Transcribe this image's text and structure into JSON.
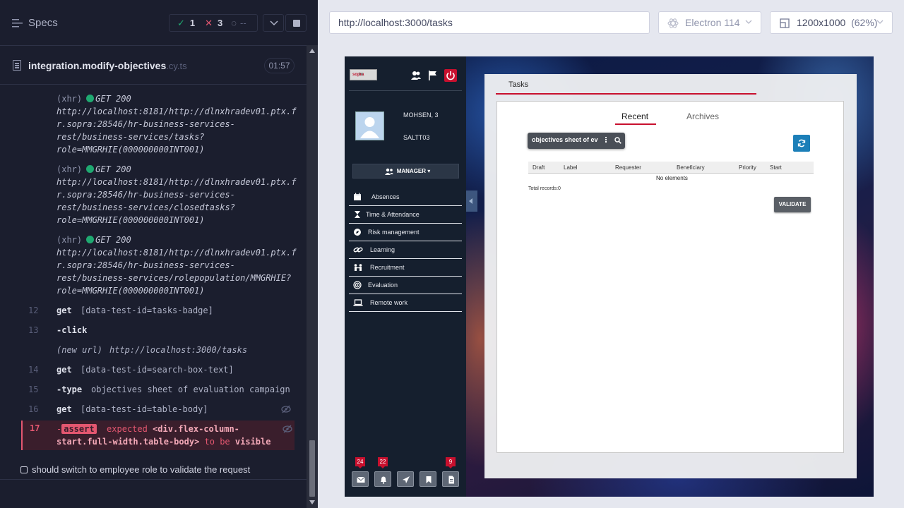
{
  "runner": {
    "specs_title": "Specs",
    "stats": {
      "passed": "1",
      "failed": "3",
      "pending": "--",
      "pass_glyph": "✓",
      "fail_glyph": "✕",
      "pending_glyph": "◌"
    },
    "spec_file": {
      "name": "integration.modify-objectives",
      "ext": ".cy.ts",
      "duration": "01:57"
    },
    "xhr_entries": [
      {
        "tag": "(xhr)",
        "status": "GET 200",
        "line1": "http://localhost:8181/http://dlnxhradev01.ptx.f",
        "line2": "r.sopra:28546/hr-business-services-",
        "line3": "rest/business-services/tasks?",
        "line4": "role=MMGRHIE(000000000INT001)"
      },
      {
        "tag": "(xhr)",
        "status": "GET 200",
        "line1": "http://localhost:8181/http://dlnxhradev01.ptx.f",
        "line2": "r.sopra:28546/hr-business-services-",
        "line3": "rest/business-services/closedtasks?",
        "line4": "role=MMGRHIE(000000000INT001)"
      },
      {
        "tag": "(xhr)",
        "status": "GET 200",
        "line1": "http://localhost:8181/http://dlnxhradev01.ptx.f",
        "line2": "r.sopra:28546/hr-business-services-",
        "line3": "rest/business-services/rolepopulation/MMGRHIE?",
        "line4": "role=MMGRHIE(000000000INT001)"
      }
    ],
    "commands": [
      {
        "num": "12",
        "name": "get",
        "arg": "[data-test-id=tasks-badge]"
      },
      {
        "num": "13",
        "name": "-click",
        "arg": ""
      },
      {
        "num": "",
        "name": "(new url)",
        "arg": "http://localhost:3000/tasks"
      },
      {
        "num": "14",
        "name": "get",
        "arg": "[data-test-id=search-box-text]"
      },
      {
        "num": "15",
        "name": "-type",
        "arg": "objectives sheet of evaluation campaign"
      },
      {
        "num": "16",
        "name": "get",
        "arg": "[data-test-id=table-body]"
      }
    ],
    "failed_command": {
      "num": "17",
      "prefix": "-",
      "badge": "assert",
      "w1": "expected",
      "w2": "<div.flex-column-",
      "w3": "start.full-width.table-body>",
      "w4": "to be",
      "w5": "visible"
    },
    "next_test": "should switch to employee role to validate the request"
  },
  "browser": {
    "url": "http://localhost:3000/tasks",
    "engine": "Electron 114",
    "viewport": "1200x1000",
    "zoom": "(62%)"
  },
  "app": {
    "logo_left": "sopra",
    "logo_right": "hr",
    "user_name": "MOHSEN, 3",
    "user_code": "SALTT03",
    "role": "MANAGER",
    "menu": [
      {
        "label": "Absences",
        "icon": "calendar-icon"
      },
      {
        "label": "Time & Attendance",
        "icon": "hourglass-icon"
      },
      {
        "label": "Risk management",
        "icon": "compass-icon"
      },
      {
        "label": "Learning",
        "icon": "link-icon"
      },
      {
        "label": "Recruitment",
        "icon": "people-icon"
      },
      {
        "label": "Evaluation",
        "icon": "target-icon"
      },
      {
        "label": "Remote work",
        "icon": "laptop-icon"
      }
    ],
    "notifications": {
      "mail_count": "24",
      "bell_count": "22",
      "doc_count": "9"
    },
    "tasks": {
      "title": "Tasks",
      "tabs": [
        "Recent",
        "Archives"
      ],
      "search_value": "objectives sheet of ev",
      "columns": [
        "Draft",
        "Label",
        "Requester",
        "Beneficiary",
        "Priority",
        "Start"
      ],
      "empty": "No elements",
      "total": "Total records:0",
      "validate": "VALIDATE"
    }
  }
}
